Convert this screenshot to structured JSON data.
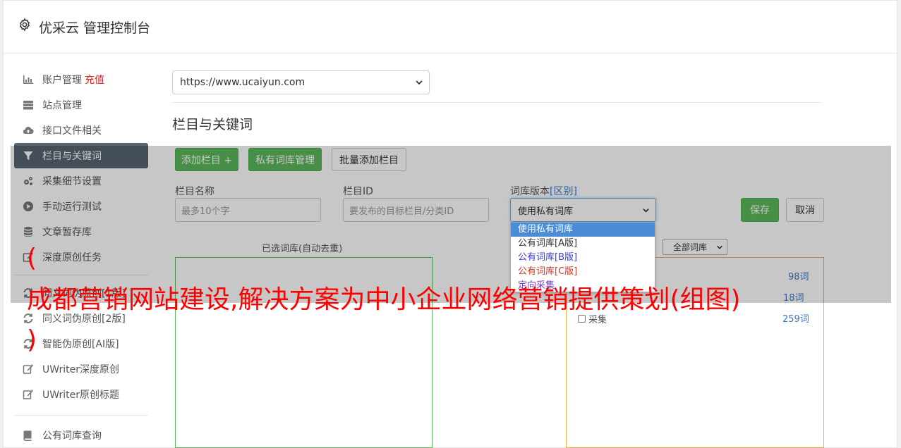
{
  "header": {
    "title": "优采云 管理控制台",
    "icon": "gear-icon"
  },
  "sidebar": {
    "recharge_label": "充值",
    "items": [
      {
        "label": "账户管理",
        "icon": "bar-chart-icon"
      },
      {
        "label": "站点管理",
        "icon": "server-icon"
      },
      {
        "label": "接口文件相关",
        "icon": "cloud-upload-icon"
      },
      {
        "label": "栏目与关键词",
        "icon": "filter-icon",
        "active": true
      },
      {
        "label": "采集细节设置",
        "icon": "cogs-icon"
      },
      {
        "label": "手动运行测试",
        "icon": "play-circle-icon"
      },
      {
        "label": "文章暂存库",
        "icon": "database-icon"
      },
      {
        "label": "深度原创任务",
        "icon": "edit-icon"
      },
      {
        "label": "同义词伪原创[1版]",
        "icon": "refresh-icon"
      },
      {
        "label": "同义词伪原创[2版]",
        "icon": "refresh-icon"
      },
      {
        "label": "智能伪原创[AI版]",
        "icon": "refresh-icon"
      },
      {
        "label": "UWriter深度原创",
        "icon": "edit-icon"
      },
      {
        "label": "UWriter原创标题",
        "icon": "edit-icon"
      },
      {
        "label": "公有词库查询",
        "icon": "book-icon"
      }
    ]
  },
  "main": {
    "site_select_value": "https://www.ucaiyun.com",
    "section_title": "栏目与关键词",
    "buttons": {
      "add_column": "添加栏目 +",
      "private_lib": "私有词库管理",
      "batch_add": "批量添加栏目",
      "save": "保存",
      "cancel": "取消"
    },
    "form": {
      "name_label": "栏目名称",
      "name_placeholder": "最多10个字",
      "id_label": "栏目ID",
      "id_placeholder": "要发布的目标栏目/分类ID",
      "lib_label": "词库版本",
      "lib_label_link": "[区别]",
      "lib_value": "使用私有词库"
    },
    "dropdown_options": [
      "使用私有词库",
      "公有词库[A版]",
      "公有词库[B版]",
      "公有词库[C版]",
      "定向采集"
    ],
    "selected_panel_title": "已选词库(自动去重)",
    "filter_select_value": "全部词库",
    "right_panel_partial": "采集",
    "counts": [
      "98词",
      "18词",
      "259词"
    ]
  },
  "banner": {
    "text": "成都营销网站建设,解决方案为中小企业网络营销提供策划(组图)",
    "paren_open": "(",
    "paren_close": ")"
  },
  "colors": {
    "active_bg": "#586571",
    "green": "#5cb85c",
    "orange": "#f0ad4e",
    "red_banner": "#ff0000",
    "link": "#3a78c3"
  }
}
